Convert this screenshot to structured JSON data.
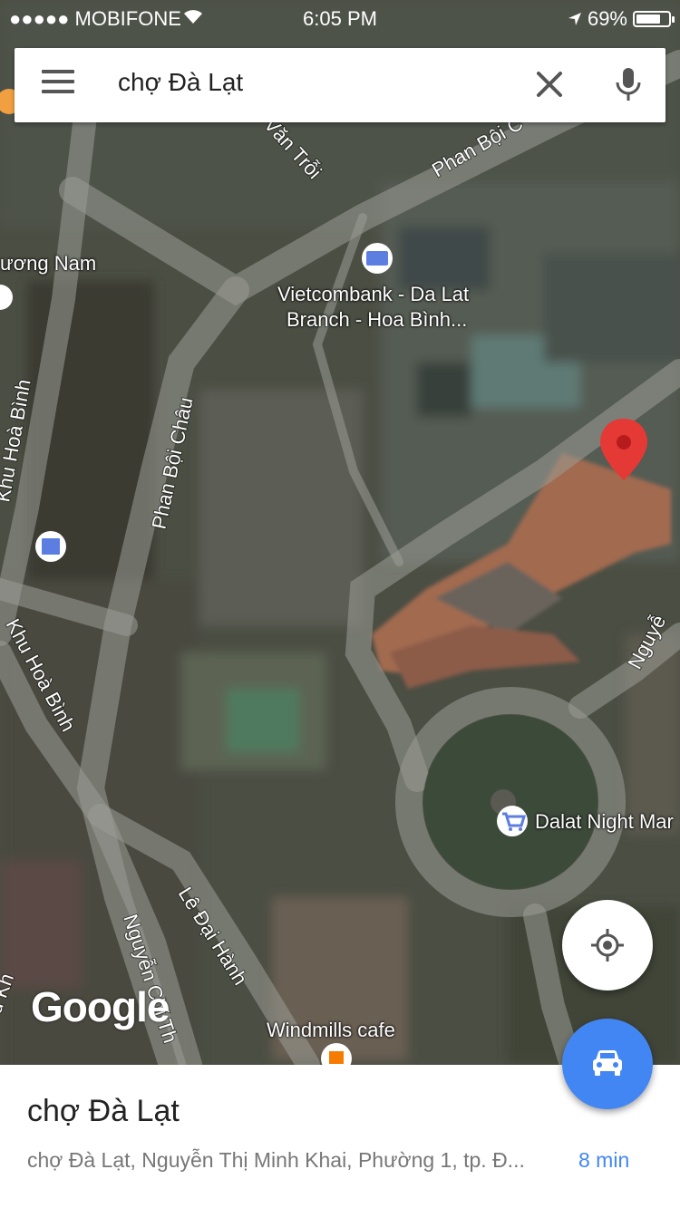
{
  "status_bar": {
    "carrier": "●●●●● MOBIFONE",
    "time": "6:05 PM",
    "battery_pct": "69%",
    "battery_level": 0.69
  },
  "search": {
    "query": "chợ Đà Lạt"
  },
  "map": {
    "streets": {
      "van_troi": "Văn Trỗi",
      "phan_boi_chau_top": "Phan Bội C",
      "phan_boi_chau": "Phan Bội Châu",
      "khu_hoa_binh_1": "Khu Hoà Bình",
      "khu_hoa_binh_2": "Khu Hoà Bình",
      "le_dai_hanh": "Lê Đại Hành",
      "nguyen_chi_thanh": "Nguyễn Chí Th",
      "nguyen_right": "Nguyễ",
      "khu_bottom_left": "u Kh"
    },
    "places": {
      "phuong_nam": "ương Nam",
      "vietcombank_line1": "Vietcombank - Da Lat",
      "vietcombank_line2": "Branch - Hoa Bình...",
      "night_market": "Dalat Night Mar",
      "windmills": "Windmills cafe"
    },
    "attribution": "Google"
  },
  "place_card": {
    "title": "chợ Đà Lạt",
    "address": "chợ Đà Lạt, Nguyễn Thị Minh Khai, Phường 1, tp. Đ...",
    "eta": "8 min"
  },
  "colors": {
    "accent": "#4286f4",
    "pin": "#e53935",
    "road": "#9a9c96"
  }
}
